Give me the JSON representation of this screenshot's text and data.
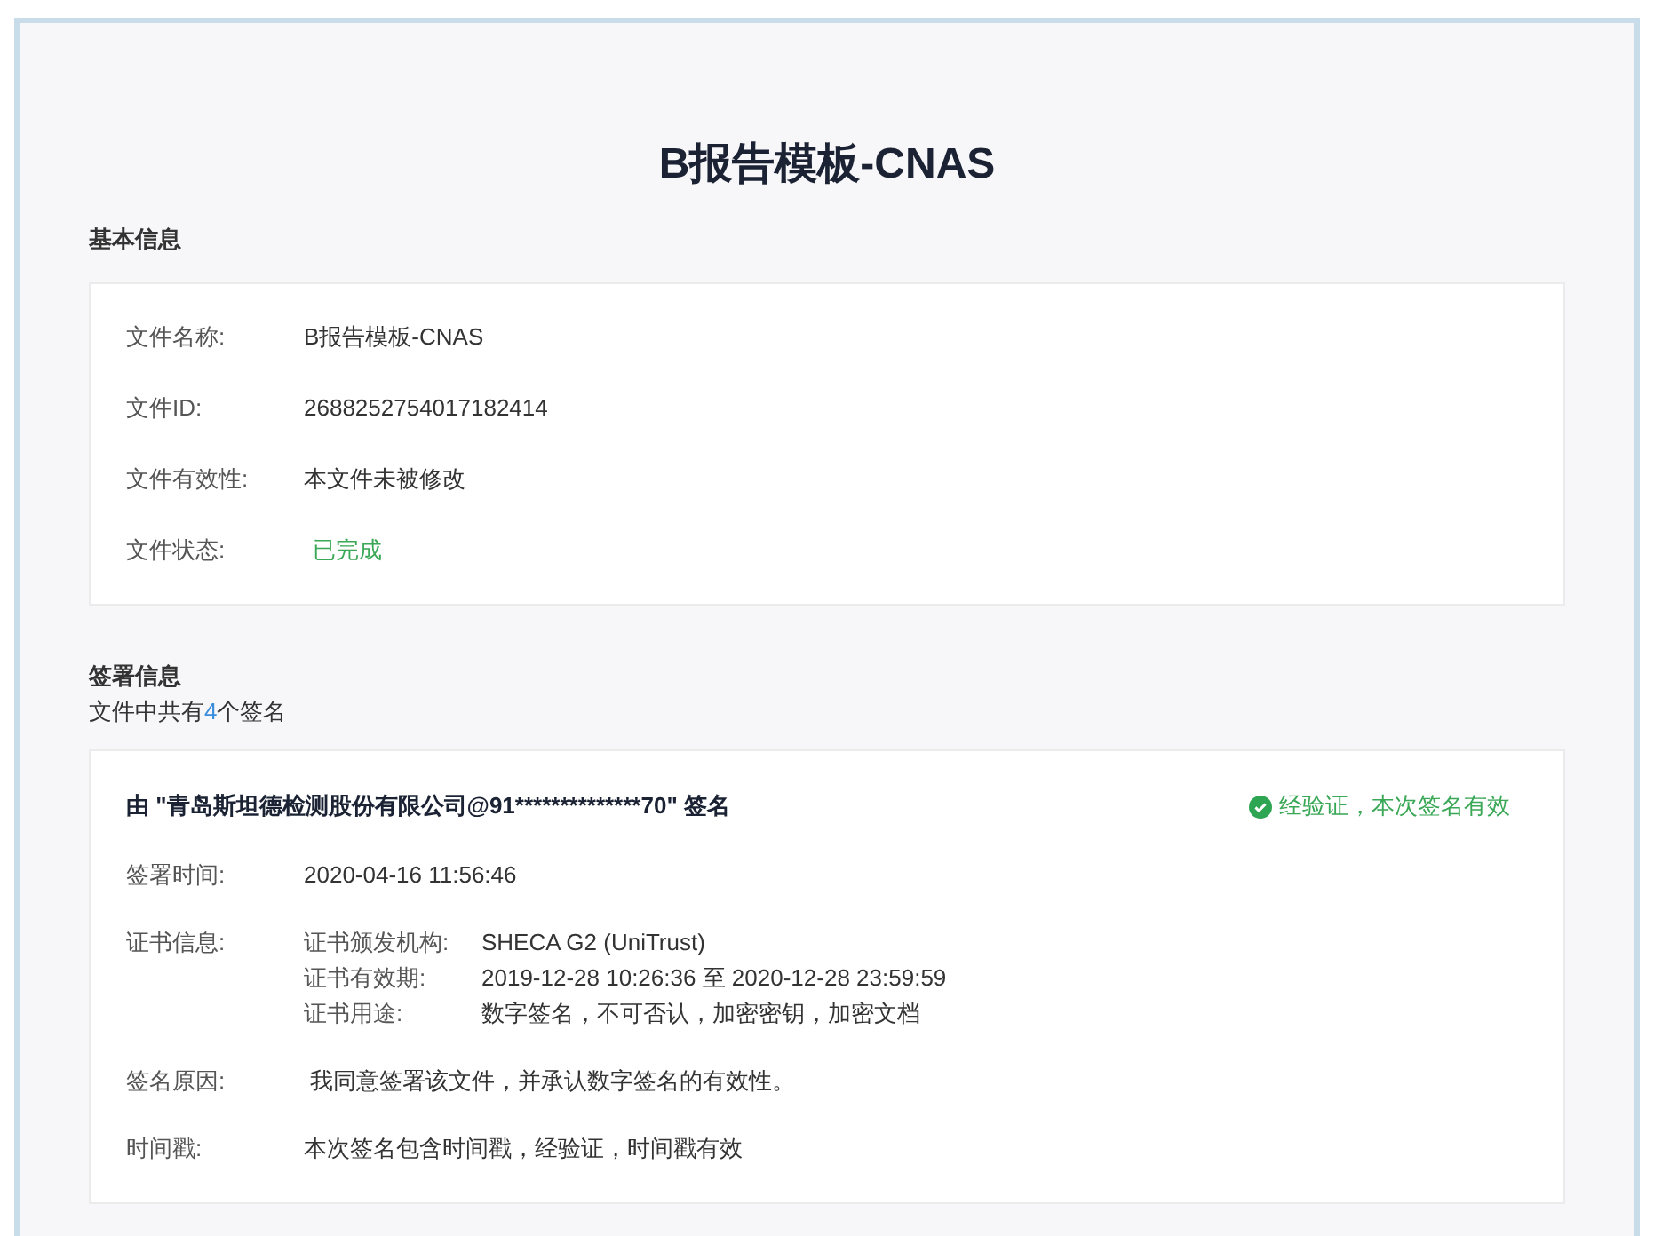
{
  "title": "B报告模板-CNAS",
  "basic_info": {
    "heading": "基本信息",
    "rows": [
      {
        "label": "文件名称:",
        "value": "B报告模板-CNAS",
        "kind": "text"
      },
      {
        "label": "文件ID:",
        "value": "2688252754017182414",
        "kind": "text"
      },
      {
        "label": "文件有效性:",
        "value": "本文件未被修改",
        "kind": "text"
      },
      {
        "label": "文件状态:",
        "value": "已完成",
        "kind": "status"
      }
    ]
  },
  "signature_info": {
    "heading": "签署信息",
    "count_before": "文件中共有",
    "count": "4",
    "count_after": "个签名",
    "signatures": [
      {
        "signer": "由 \"青岛斯坦德检测股份有限公司@91**************70\" 签名",
        "valid": true,
        "validity_text": "经验证，本次签名有效",
        "rows": [
          {
            "kind": "text",
            "label": "签署时间:",
            "value": "2020-04-16 11:56:46"
          },
          {
            "kind": "pairs",
            "label": "证书信息:",
            "pairs": [
              {
                "label": "证书颁发机构:",
                "value": "SHECA G2 (UniTrust)"
              },
              {
                "label": "证书有效期:",
                "value": "2019-12-28 10:26:36 至 2020-12-28 23:59:59"
              },
              {
                "label": "证书用途:",
                "value": "数字签名，不可否认，加密密钥，加密文档"
              }
            ]
          },
          {
            "kind": "text",
            "label": "签名原因:",
            "value": " 我同意签署该文件，并承认数字签名的有效性。"
          },
          {
            "kind": "text",
            "label": "时间戳:",
            "value": "本次签名包含时间戳，经验证，时间戳有效"
          }
        ]
      }
    ]
  }
}
